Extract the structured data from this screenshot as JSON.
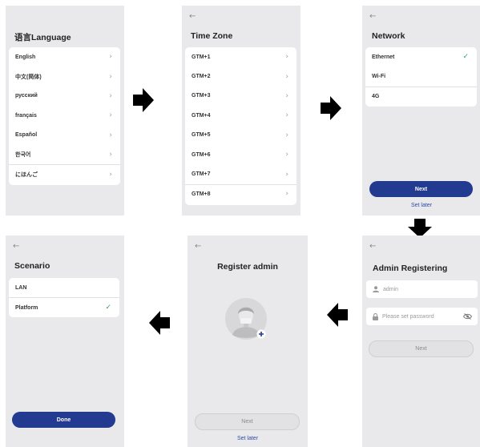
{
  "colors": {
    "panel_bg": "#e9e9eb",
    "primary_button": "#223a8f",
    "check": "#2e9e6a",
    "link": "#2b4aa8"
  },
  "icons": {
    "back": "←",
    "chevron": "›",
    "check": "✓"
  },
  "language": {
    "title": "语言Language",
    "items": [
      "English",
      "中文(简体)",
      "русский",
      "français",
      "Español",
      "한국어",
      "にほんご"
    ]
  },
  "timezone": {
    "title": "Time Zone",
    "items": [
      "GTM+1",
      "GTM+2",
      "GTM+3",
      "GTM+4",
      "GTM+5",
      "GTM+6",
      "GTM+7",
      "GTM+8"
    ]
  },
  "network": {
    "title": "Network",
    "items": [
      "Ethernet",
      "Wi-Fi",
      "4G"
    ],
    "next_label": "Next",
    "set_later_label": "Set later"
  },
  "admin_registering": {
    "title": "Admin Registering",
    "username_value": "admin",
    "password_placeholder": "Please set password",
    "next_label": "Next"
  },
  "register_admin": {
    "title": "Register admin",
    "next_label": "Next",
    "set_later_label": "Set later"
  },
  "scenario": {
    "title": "Scenario",
    "items": [
      "LAN",
      "Platform"
    ],
    "done_label": "Done"
  }
}
